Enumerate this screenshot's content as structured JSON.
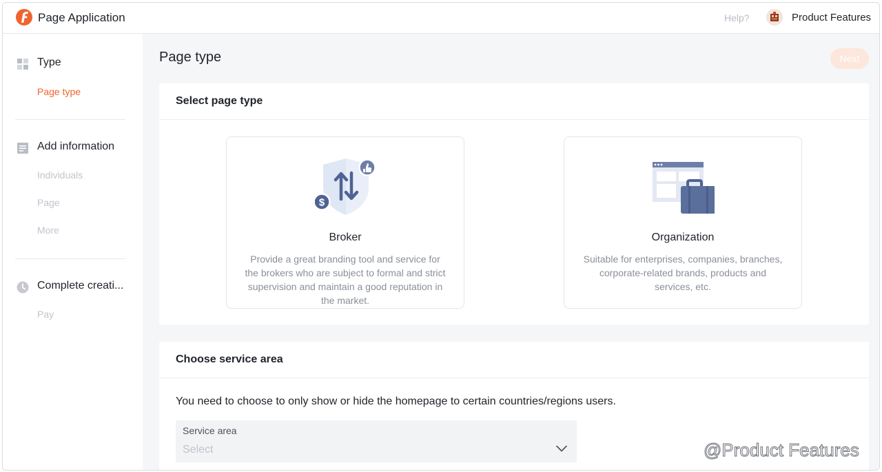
{
  "app": {
    "title": "Page Application"
  },
  "header": {
    "help_label": "Help?",
    "user_name": "Product Features"
  },
  "sidebar": {
    "steps": [
      {
        "label": "Type",
        "icon": "grid-icon",
        "subs": [
          "Page type"
        ]
      },
      {
        "label": "Add information",
        "icon": "document-icon",
        "subs": [
          "Individuals",
          "Page",
          "More"
        ]
      },
      {
        "label": "Complete creati...",
        "icon": "clock-icon",
        "subs": [
          "Pay"
        ]
      }
    ],
    "active_sub": "Page type"
  },
  "main": {
    "page_title": "Page type",
    "next_label": "Next",
    "select_type": {
      "heading": "Select page type",
      "options": [
        {
          "name": "Broker",
          "icon": "shield-exchange-icon",
          "description": "Provide a great branding tool and service for the brokers who are subject to formal and strict supervision and maintain a good reputation in the market."
        },
        {
          "name": "Organization",
          "icon": "briefcase-window-icon",
          "description": "Suitable for enterprises, companies, branches, corporate-related brands, products and services, etc."
        }
      ]
    },
    "service_area": {
      "heading": "Choose service area",
      "instruction": "You need to choose to only show or hide the homepage to certain countries/regions users.",
      "field_label": "Service area",
      "placeholder": "Select"
    }
  },
  "watermark": "@Product Features",
  "colors": {
    "accent": "#f0652f",
    "accent_light": "#fde6dc",
    "icon_blue": "#5b6f9c",
    "main_bg": "#f5f6f7"
  }
}
